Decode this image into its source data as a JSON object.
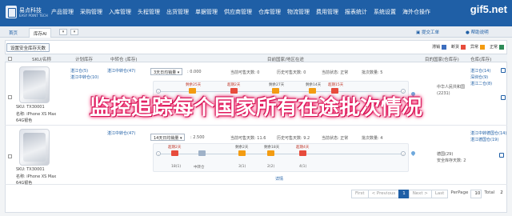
{
  "brand": {
    "name": "易点科技",
    "sub": "EASY POINT TECH"
  },
  "watermark": "gif5.net",
  "menu": [
    "产品管理",
    "采购管理",
    "入库管理",
    "头程管理",
    "出货管理",
    "单据管理",
    "供应商管理",
    "仓库管理",
    "物流管理",
    "费用管理",
    "报表统计",
    "系统设置",
    "海外仓操作"
  ],
  "tabs": {
    "home": "首页",
    "active": "库存AI"
  },
  "tabbar_right": {
    "ticket": "提交工单",
    "help": "帮助说明"
  },
  "toolbar": {
    "set_safety_btn": "设置安全库存天数"
  },
  "legend": [
    {
      "label": "滞销",
      "color": "#3c6ebf"
    },
    {
      "label": "断货",
      "color": "#e74c3c"
    },
    {
      "label": "异常",
      "color": "#f39c12"
    },
    {
      "label": "正常",
      "color": "#2e8b57"
    }
  ],
  "columns": [
    "SKU/名称",
    "计划库存",
    "中转仓 (库存)",
    "目前国家/地区在途",
    "目的国家(仓库存)",
    "仓库(库存)"
  ],
  "rows": [
    {
      "sku": "SKU: TX30001",
      "name": "名称: iPhone XS Max",
      "variant": "64G银色",
      "warehouses": [
        "湛江仓(5)",
        "湛江中转仓(10)"
      ],
      "transit_wh": "湛江中转仓(47)",
      "daily_select": "3天日均销量",
      "daily_value": ": 0.000",
      "stats": [
        "当前可售天数: 0",
        "历史可售天数: 0",
        "当前状态: 正常",
        "批次数量: 5"
      ],
      "nodes": [
        {
          "label": "剩余25天",
          "qty": ""
        },
        {
          "label": "超期2天",
          "qty": ""
        },
        {
          "label": "剩余27天",
          "qty": ""
        },
        {
          "label": "剩余14天",
          "qty": ""
        },
        {
          "label": "超期15天",
          "qty": ""
        }
      ],
      "dest": [
        "中华人民共和国(2231)"
      ],
      "dest_wh": [
        "湛江仓(14)",
        "深圳仓(9)",
        "湛江二仓(8)"
      ]
    },
    {
      "sku": "SKU: TX30001",
      "name": "名称: iPhone XS Max",
      "variant": "64G银色",
      "warehouses": [],
      "transit_wh": "湛江中转仓(47)",
      "daily_select": "14天日均销量",
      "daily_value": ": 2.500",
      "stats": [
        "当前可售天数: 11.6",
        "历史可售天数: 9.2",
        "当前状态: 正常",
        "批次数量: 4"
      ],
      "nodes": [
        {
          "label": "超期2天",
          "qty": "18(1)"
        },
        {
          "label": "",
          "qty": "中转仓"
        },
        {
          "label": "剩余2天",
          "qty": "3(1)"
        },
        {
          "label": "剩余18天",
          "qty": "2(2)"
        },
        {
          "label": "超期4天",
          "qty": "4(1)"
        }
      ],
      "detail": "详情",
      "dest": [
        "德国(29)",
        "安全库存天数: 2"
      ],
      "dest_wh": [
        "湛江中转德国仓(14)",
        "湛江德国仓(19)"
      ]
    }
  ],
  "overlay_caption": "监控追踪每个国家所有在途批次情况",
  "pagination": {
    "first": "First",
    "prev": "< Previous",
    "page": "1",
    "next": "Next >",
    "last": "Last",
    "perpage_label": "PerPage",
    "perpage": "10",
    "total_label": "Total",
    "total": "2"
  }
}
